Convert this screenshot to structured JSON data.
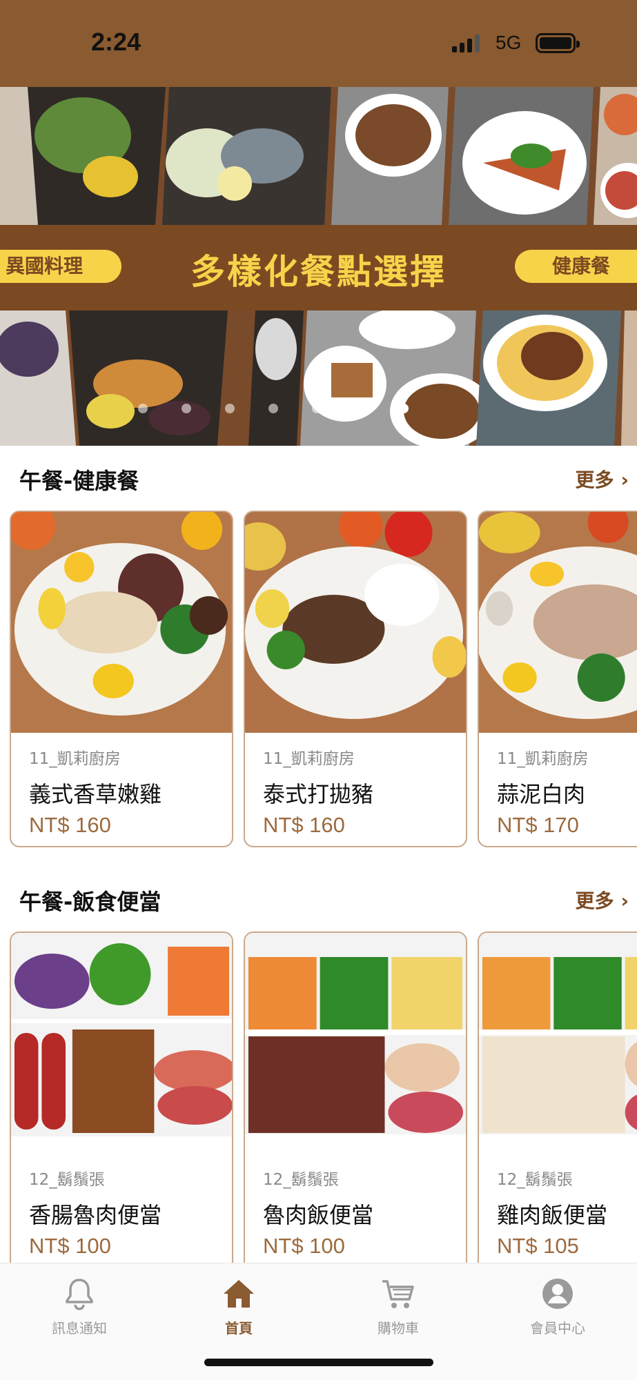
{
  "status_bar": {
    "time": "2:24",
    "network": "5G"
  },
  "banner": {
    "title": "多樣化餐點選擇",
    "left_tag": "異國料理",
    "right_tag": "健康餐",
    "dot_count": 7,
    "active_dot": 6
  },
  "sections": [
    {
      "title": "午餐-健康餐",
      "more_label": "更多",
      "items": [
        {
          "vendor": "11_凱莉廚房",
          "name": "義式香草嫩雞",
          "price": "NT$ 160"
        },
        {
          "vendor": "11_凱莉廚房",
          "name": "泰式打拋豬",
          "price": "NT$ 160"
        },
        {
          "vendor": "11_凱莉廚房",
          "name": "蒜泥白肉",
          "price": "NT$ 170"
        }
      ]
    },
    {
      "title": "午餐-飯食便當",
      "more_label": "更多",
      "items": [
        {
          "vendor": "12_鬍鬚張",
          "name": "香腸魯肉便當",
          "price": "NT$ 100"
        },
        {
          "vendor": "12_鬍鬚張",
          "name": "魯肉飯便當",
          "price": "NT$ 100"
        },
        {
          "vendor": "12_鬍鬚張",
          "name": "雞肉飯便當",
          "price": "NT$ 105"
        }
      ]
    }
  ],
  "bottom_nav": [
    {
      "label": "訊息通知",
      "icon": "bell-icon"
    },
    {
      "label": "首頁",
      "icon": "home-icon",
      "active": true
    },
    {
      "label": "購物車",
      "icon": "cart-icon"
    },
    {
      "label": "會員中心",
      "icon": "user-icon"
    }
  ],
  "colors": {
    "brand_brown": "#8a5a30",
    "accent_yellow": "#f7d34a",
    "price_brown": "#9c6a3e"
  }
}
